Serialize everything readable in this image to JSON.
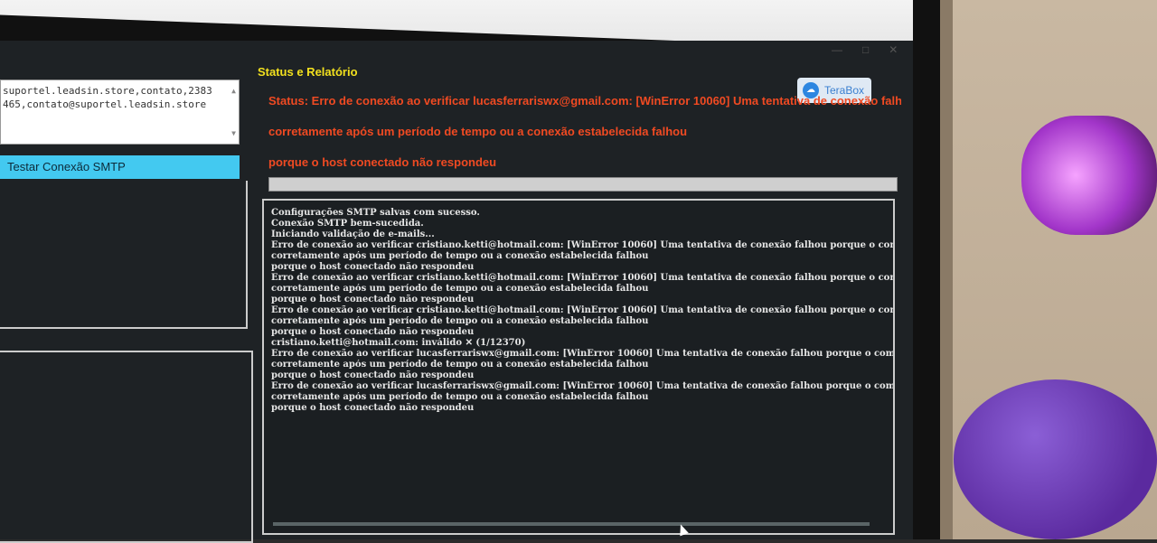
{
  "window": {
    "min_label": "—",
    "max_label": "□",
    "close_label": "✕"
  },
  "recipients": {
    "line1": "suportel.leadsin.store,contato,2383",
    "line2": "465,contato@suportel.leadsin.store",
    "scroll_up": "▲",
    "scroll_down": "▼"
  },
  "smtp_button": "Testar Conexão SMTP",
  "section_title": "Status e Relatório",
  "terabox": {
    "label": "TeraBox",
    "icon": "cloud-icon"
  },
  "status_lines": [
    "Status: Erro de conexão ao verificar lucasferrariswx@gmail.com: [WinError 10060] Uma tentativa de conexão falhou porque o",
    "corretamente após um período de tempo ou a conexão estabelecida falhou",
    "porque o host conectado não respondeu"
  ],
  "progress": {
    "value": 0
  },
  "log": [
    "Configurações SMTP salvas com sucesso.",
    "Conexão SMTP bem-sucedida.",
    "Iniciando validação de e-mails...",
    "Erro de conexão ao verificar cristiano.ketti@hotmail.com: [WinError 10060] Uma tentativa de conexão falhou porque o com",
    "corretamente após um período de tempo ou a conexão estabelecida falhou",
    "porque o host conectado não respondeu",
    "Erro de conexão ao verificar cristiano.ketti@hotmail.com: [WinError 10060] Uma tentativa de conexão falhou porque o com",
    "corretamente após um período de tempo ou a conexão estabelecida falhou",
    "porque o host conectado não respondeu",
    "Erro de conexão ao verificar cristiano.ketti@hotmail.com: [WinError 10060] Uma tentativa de conexão falhou porque o com",
    "corretamente após um período de tempo ou a conexão estabelecida falhou",
    "porque o host conectado não respondeu",
    "cristiano.ketti@hotmail.com: inválido ✕ (1/12370)",
    "Erro de conexão ao verificar lucasferrariswx@gmail.com: [WinError 10060] Uma tentativa de conexão falhou porque o compo",
    "corretamente após um período de tempo ou a conexão estabelecida falhou",
    "porque o host conectado não respondeu",
    "Erro de conexão ao verificar lucasferrariswx@gmail.com: [WinError 10060] Uma tentativa de conexão falhou porque o compo",
    "corretamente após um período de tempo ou a conexão estabelecida falhou",
    "porque o host conectado não respondeu"
  ]
}
